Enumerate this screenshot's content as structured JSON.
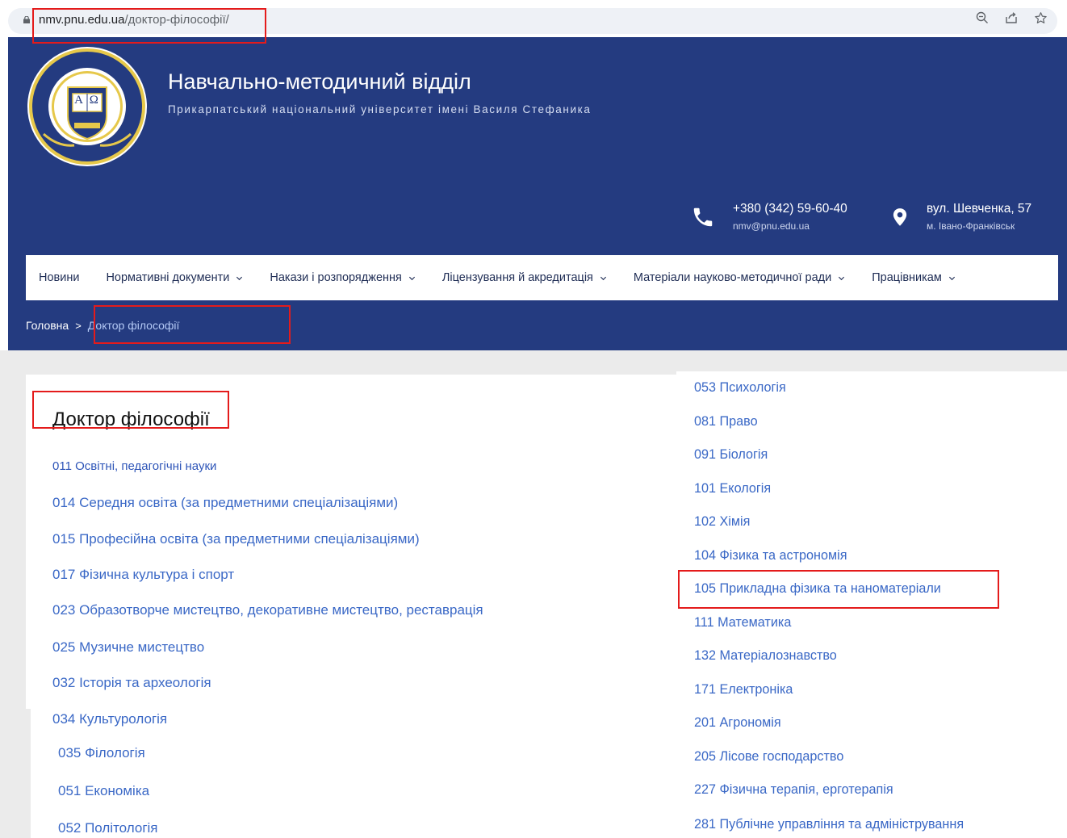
{
  "browser": {
    "url_domain": "nmv.pnu.edu.ua",
    "url_path": "/доктор-філософії/",
    "icons": [
      "zoom-icon",
      "share-icon",
      "bookmark-star-icon"
    ]
  },
  "header": {
    "title": "Навчально-методичний відділ",
    "subtitle": "Прикарпатський національний університет імені Василя Стефаника",
    "logo_center_text": "А Ω",
    "phone": "+380 (342) 59-60-40",
    "email": "nmv@pnu.edu.ua",
    "address": "вул. Шевченка, 57",
    "city": "м. Івано-Франківськ"
  },
  "nav": {
    "items": [
      {
        "label": "Новини",
        "has_dropdown": false
      },
      {
        "label": "Нормативні документи",
        "has_dropdown": true
      },
      {
        "label": "Накази і розпорядження",
        "has_dropdown": true
      },
      {
        "label": "Ліцензування й акредитація",
        "has_dropdown": true
      },
      {
        "label": "Матеріали науково-методичної ради",
        "has_dropdown": true
      },
      {
        "label": "Працівникам",
        "has_dropdown": true
      }
    ]
  },
  "breadcrumb": {
    "home": "Головна",
    "separator": ">",
    "current": "Доктор філософії"
  },
  "page": {
    "title": "Доктор філософії",
    "left_links": [
      "011 Освітні, педагогічні науки",
      "014 Середня освіта (за предметними спеціалізаціями)",
      "015 Професійна освіта (за предметними спеціалізаціями)",
      "017 Фізична культура і спорт",
      "023 Образотворче мистецтво, декоративне мистецтво, реставрація",
      "025 Музичне мистецтво",
      "032 Історія та археологія",
      "034 Культурологія",
      "035 Філологія",
      "051 Економіка",
      "052 Політологія"
    ],
    "right_links": [
      "053 Психологія",
      "081 Право",
      "091 Біологія",
      "101 Екологія",
      "102 Хімія",
      "104 Фізика та астрономія",
      "105 Прикладна фізика та наноматеріали",
      "111 Математика",
      "132 Матеріалознавство",
      "171 Електроніка",
      "201 Агрономія",
      "205 Лісове господарство",
      "227 Фізична терапія, ерготерапія",
      "281 Публічне управління та адміністрування"
    ]
  },
  "colors": {
    "header_bg": "#243b80",
    "link": "#3a68c6",
    "highlight": "#e41b1b"
  }
}
